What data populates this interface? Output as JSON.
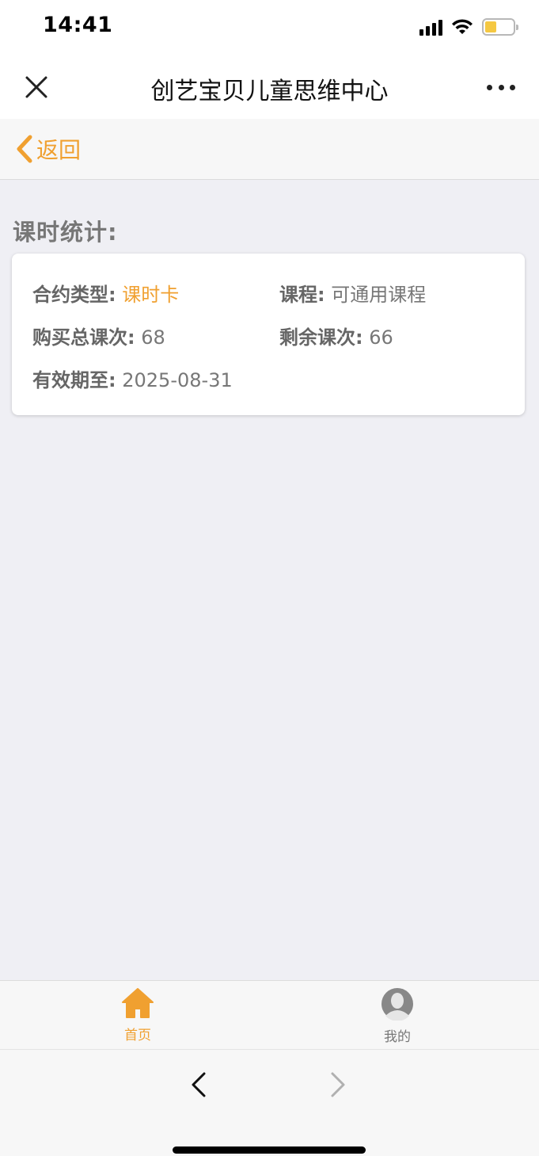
{
  "status_bar": {
    "time": "14:41"
  },
  "nav": {
    "title": "创艺宝贝儿童思维中心"
  },
  "back": {
    "label": "返回"
  },
  "section": {
    "title": "课时统计:"
  },
  "stats": {
    "contract_type": {
      "label": "合约类型:",
      "value": "课时卡"
    },
    "course": {
      "label": "课程:",
      "value": "可通用课程"
    },
    "total_purchased": {
      "label": "购买总课次:",
      "value": "68"
    },
    "remaining": {
      "label": "剩余课次:",
      "value": "66"
    },
    "valid_until": {
      "label": "有效期至:",
      "value": "2025-08-31"
    }
  },
  "tabs": [
    {
      "label": "首页",
      "icon": "home-icon",
      "active": true
    },
    {
      "label": "我的",
      "icon": "user-icon",
      "active": false
    }
  ],
  "colors": {
    "accent": "#f0a030",
    "text_gray": "#777777",
    "background": "#efeff4"
  }
}
